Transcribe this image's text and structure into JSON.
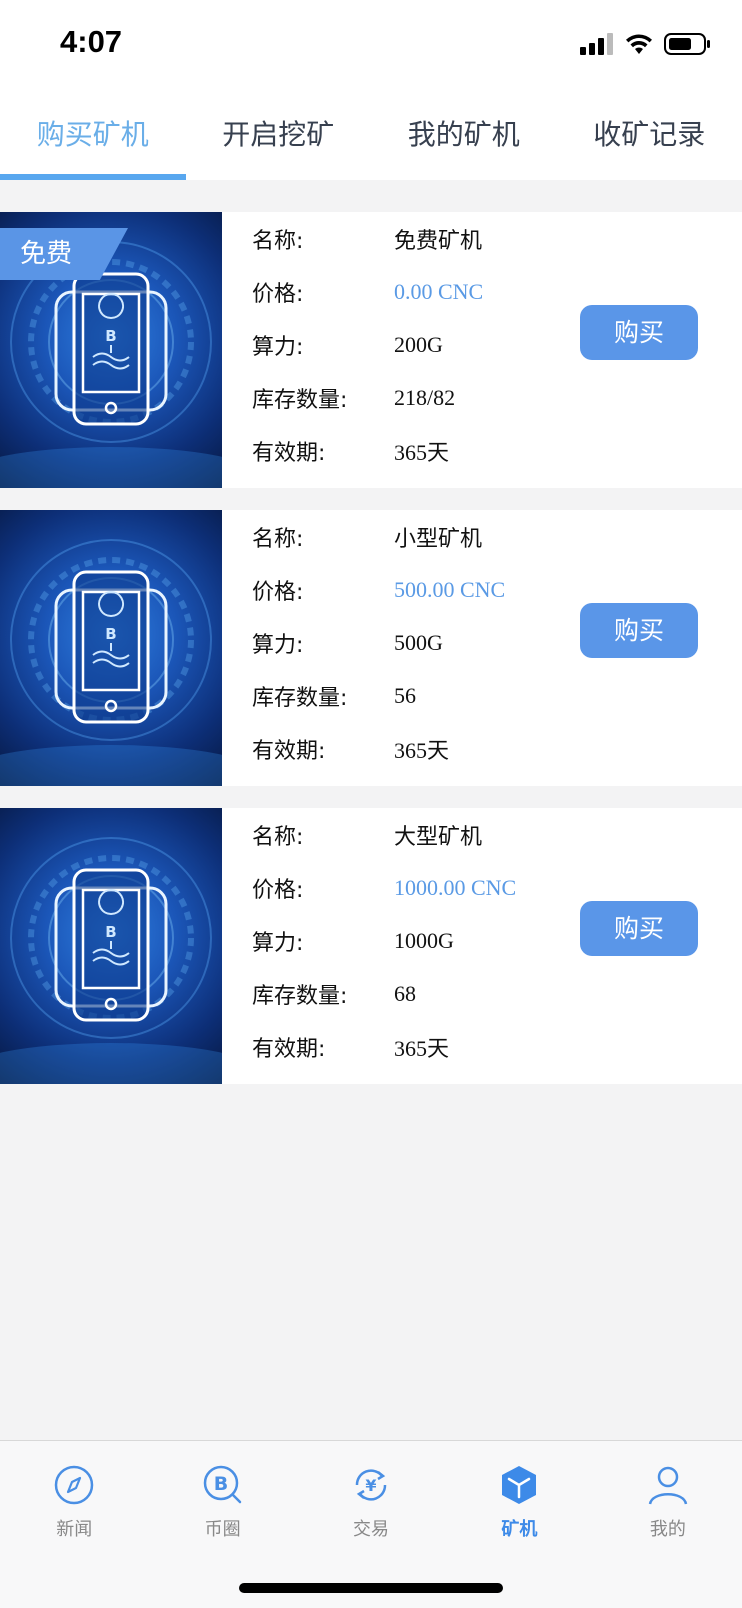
{
  "status_bar": {
    "time": "4:07"
  },
  "tabs": [
    {
      "label": "购买矿机",
      "active": true
    },
    {
      "label": "开启挖矿",
      "active": false
    },
    {
      "label": "我的矿机",
      "active": false
    },
    {
      "label": "收矿记录",
      "active": false
    }
  ],
  "labels": {
    "name": "名称:",
    "price": "价格:",
    "hashrate": "算力:",
    "stock": "库存数量:",
    "validity": "有效期:"
  },
  "cards": [
    {
      "ribbon": "免费",
      "name": "免费矿机",
      "price": "0.00 CNC",
      "hashrate": "200G",
      "stock": "218/82",
      "validity": "365天",
      "button": "购买"
    },
    {
      "name": "小型矿机",
      "price": "500.00 CNC",
      "hashrate": "500G",
      "stock": "56",
      "validity": "365天",
      "button": "购买"
    },
    {
      "name": "大型矿机",
      "price": "1000.00 CNC",
      "hashrate": "1000G",
      "stock": "68",
      "validity": "365天",
      "button": "购买"
    }
  ],
  "bottom_nav": [
    {
      "label": "新闻",
      "icon": "compass-icon",
      "active": false
    },
    {
      "label": "币圈",
      "icon": "bitcoin-search-icon",
      "active": false
    },
    {
      "label": "交易",
      "icon": "yuan-exchange-icon",
      "active": false
    },
    {
      "label": "矿机",
      "icon": "cube-icon",
      "active": true
    },
    {
      "label": "我的",
      "icon": "person-icon",
      "active": false
    }
  ],
  "colors": {
    "accent": "#5a96e8",
    "price": "#5a9ae5",
    "active_tab": "#6aaee8"
  }
}
